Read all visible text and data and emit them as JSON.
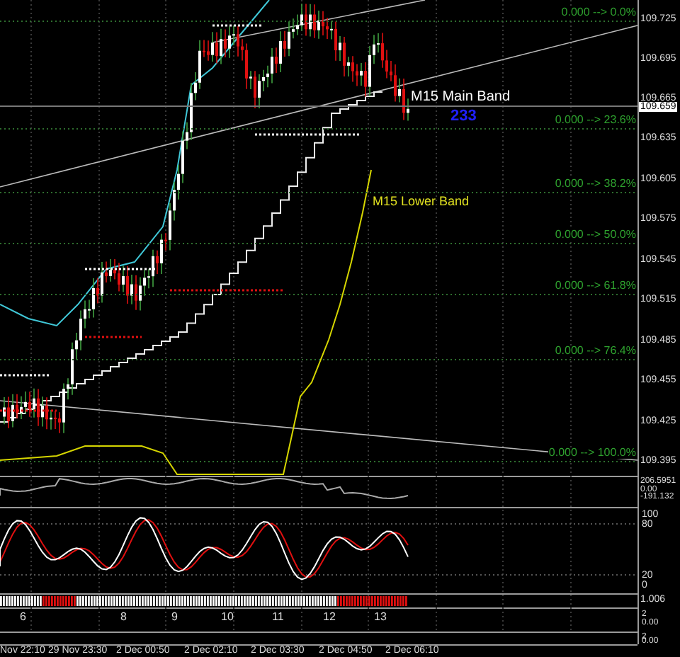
{
  "price_axis": {
    "labels": [
      "109.725",
      "109.695",
      "109.665",
      "109.635",
      "109.605",
      "109.575",
      "109.545",
      "109.515",
      "109.485",
      "109.455",
      "109.425",
      "109.395"
    ],
    "current_price": "109.659"
  },
  "fibonacci_levels": [
    "0.000 --> 0.0%",
    "0.000 --> 23.6%",
    "0.000 --> 38.2%",
    "0.000 --> 50.0%",
    "0.000 --> 61.8%",
    "0.000 --> 76.4%",
    "0.000 --> 100.0%"
  ],
  "band_labels": [
    "M15 Main Band",
    "M15 Lower Band"
  ],
  "signal_count": "233",
  "oscillator_axis": [
    "206.5951",
    "0.00",
    "-191.132"
  ],
  "stochastic_axis": [
    "100",
    "80",
    "20",
    "0"
  ],
  "histogram_axis": [
    "1.006"
  ],
  "panel_4_axis": [
    "2",
    "0.00"
  ],
  "panel_5_axis": [
    "2",
    "0.00"
  ],
  "bar_numbers": [
    "6",
    "8",
    "9",
    "10",
    "11",
    "12",
    "13"
  ],
  "time_axis": [
    "Nov 22:10",
    "29 Nov 23:30",
    "2 Dec 00:50",
    "2 Dec 02:10",
    "2 Dec 03:30",
    "2 Dec 04:50",
    "2 Dec 06:10"
  ]
}
